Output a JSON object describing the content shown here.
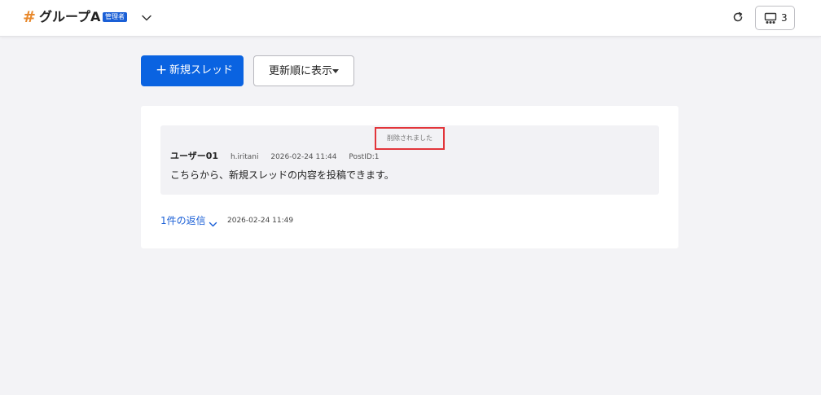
{
  "header": {
    "hash_symbol": "#",
    "group_name": "グループA",
    "admin_badge": "管理者",
    "member_count": "3"
  },
  "toolbar": {
    "new_thread_label": "新規スレッド",
    "new_thread_icon": "+",
    "sort_label": "更新順に表示"
  },
  "thread": {
    "deleted_note": "削除されました",
    "post": {
      "user": "ユーザー01",
      "handle": "h.iritani",
      "timestamp": "2026-02-24 11:44",
      "post_id": "PostID:1",
      "body": "こちらから、新規スレッドの内容を投稿できます。"
    },
    "replies_label": "1件の返信",
    "replies_timestamp": "2026-02-24 11:49"
  },
  "colors": {
    "accent": "#0a63e1",
    "hash": "#e8882b",
    "highlight_border": "#e2353a",
    "link": "#1a5fd6"
  },
  "icons": {
    "group_dropdown": "chevron-down-icon",
    "reload": "reload-icon",
    "members": "presentation-icon",
    "sort": "caret-down-icon",
    "replies": "chevron-down-icon"
  }
}
